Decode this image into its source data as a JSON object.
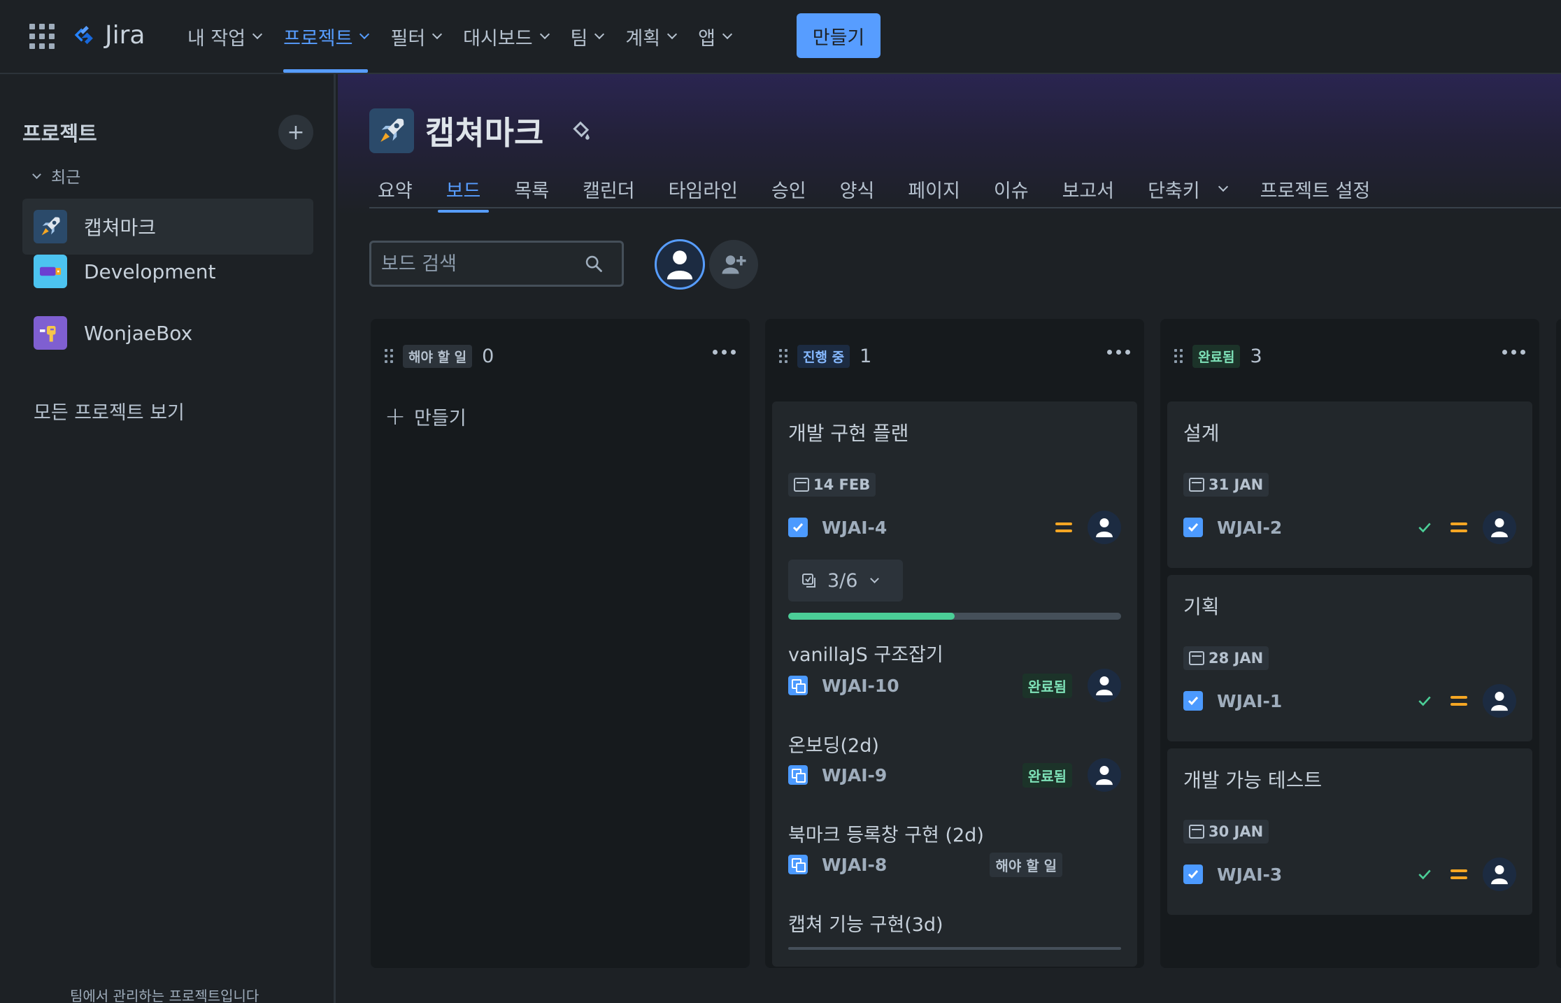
{
  "topnav": {
    "app_name": "Jira",
    "items": [
      {
        "label": "내 작업",
        "active": false
      },
      {
        "label": "프로젝트",
        "active": true
      },
      {
        "label": "필터",
        "active": false
      },
      {
        "label": "대시보드",
        "active": false
      },
      {
        "label": "팀",
        "active": false
      },
      {
        "label": "계획",
        "active": false
      },
      {
        "label": "앱",
        "active": false
      }
    ],
    "create_label": "만들기"
  },
  "sidebar": {
    "title": "프로젝트",
    "recent_label": "최근",
    "projects": [
      {
        "name": "캡쳐마크",
        "selected": true
      },
      {
        "name": "Development",
        "selected": false
      },
      {
        "name": "WonjaeBox",
        "selected": false
      }
    ],
    "view_all": "모든 프로젝트 보기",
    "footer": "팀에서 관리하는 프로젝트입니다"
  },
  "project": {
    "title": "캡쳐마크",
    "tabs": [
      {
        "label": "요약",
        "active": false
      },
      {
        "label": "보드",
        "active": true
      },
      {
        "label": "목록",
        "active": false
      },
      {
        "label": "캘린더",
        "active": false
      },
      {
        "label": "타임라인",
        "active": false
      },
      {
        "label": "승인",
        "active": false
      },
      {
        "label": "양식",
        "active": false
      },
      {
        "label": "페이지",
        "active": false
      },
      {
        "label": "이슈",
        "active": false
      },
      {
        "label": "보고서",
        "active": false
      },
      {
        "label": "단축키",
        "active": false
      },
      {
        "label": "프로젝트 설정",
        "active": false
      }
    ],
    "search_placeholder": "보드 검색"
  },
  "board": {
    "columns": [
      {
        "status": "해야 할 일",
        "count": "0",
        "create_label": "만들기",
        "cards": []
      },
      {
        "status": "진행 중",
        "count": "1",
        "cards": [
          {
            "title": "개발 구현 플랜",
            "date": "14 FEB",
            "key": "WJAI-4",
            "child_count": "3/6",
            "progress": 0.5,
            "children": [
              {
                "title": "vanillaJS 구조잡기",
                "key": "WJAI-10",
                "status": "완료됨"
              },
              {
                "title": "온보딩(2d)",
                "key": "WJAI-9",
                "status": "완료됨"
              },
              {
                "title": "북마크 등록창 구현 (2d)",
                "key": "WJAI-8",
                "status": "해야 할 일"
              },
              {
                "title": "캡쳐 기능 구현(3d)"
              }
            ]
          }
        ]
      },
      {
        "status": "완료됨",
        "count": "3",
        "cards": [
          {
            "title": "설계",
            "date": "31 JAN",
            "key": "WJAI-2"
          },
          {
            "title": "기획",
            "date": "28 JAN",
            "key": "WJAI-1"
          },
          {
            "title": "개발 가능 테스트",
            "date": "30 JAN",
            "key": "WJAI-3"
          }
        ]
      }
    ]
  },
  "colors": {
    "accent": "#579dff",
    "done_green": "#4bce97",
    "priority_medium": "#f5a623"
  }
}
